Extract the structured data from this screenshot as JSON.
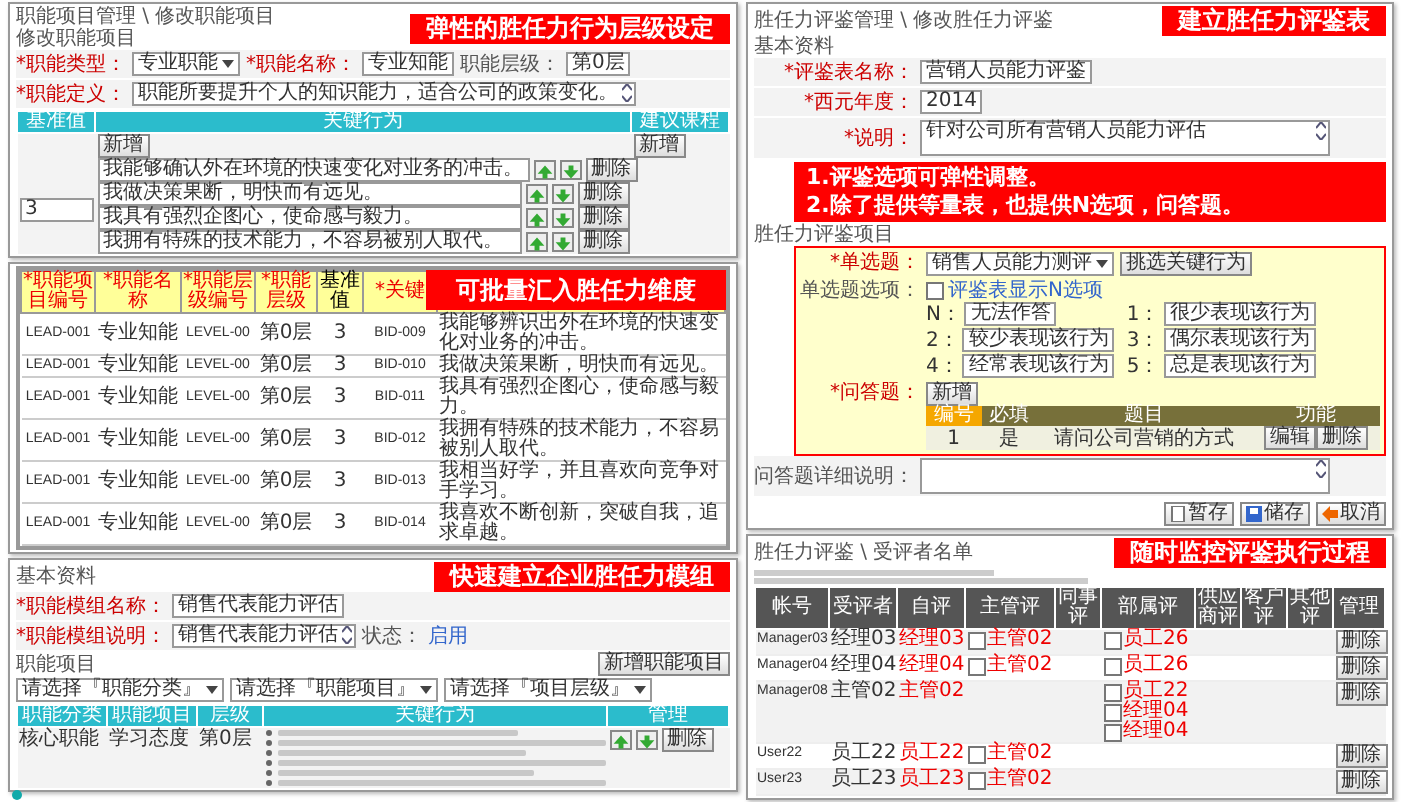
{
  "level_panel": {
    "breadcrumb": "职能项目管理 \\ 修改职能项目",
    "section_title": "修改职能项目",
    "banner": "弹性的胜任力行为层级设定",
    "field_rows": [
      [
        {
          "label": "*职能类型：",
          "kind": "select",
          "value": "专业职能"
        },
        {
          "label": "*职能名称：",
          "kind": "input",
          "value": "专业知能"
        },
        {
          "label": "职能层级：",
          "kind": "input",
          "value": "第0层"
        }
      ],
      [
        {
          "label": "*职能定义：",
          "kind": "textarea",
          "value": "职能所要提升个人的知识能力，适合公司的政策变化。"
        }
      ]
    ],
    "columns": [
      "基准值",
      "关键行为",
      "建议课程"
    ],
    "add_button": "新增",
    "course_add_button": "新增",
    "baseline_value": "3",
    "behaviors": [
      {
        "text": "我能够确认外在环境的快速变化对业务的冲击。",
        "delete": "删除"
      },
      {
        "text": "我做决策果断，明快而有远见。",
        "delete": "删除"
      },
      {
        "text": "我具有强烈企图心，使命感与毅力。",
        "delete": "删除"
      },
      {
        "text": "我拥有特殊的技术能力，不容易被别人取代。",
        "delete": "删除"
      }
    ]
  },
  "import_panel": {
    "banner": "可批量汇入胜任力维度",
    "columns": [
      {
        "label": "*职能项目编号",
        "required": true
      },
      {
        "label": "*职能名称",
        "required": true
      },
      {
        "label": "*职能层级编号",
        "required": true
      },
      {
        "label": "*职能层级",
        "required": true
      },
      {
        "label": "基准值",
        "required": false
      },
      {
        "label": "*关键",
        "required": true
      }
    ],
    "rows": [
      [
        "LEAD-001",
        "专业知能",
        "LEVEL-00",
        "第0层",
        "3",
        "BID-009",
        "我能够辨识出外在环境的快速变化对业务的冲击。"
      ],
      [
        "LEAD-001",
        "专业知能",
        "LEVEL-00",
        "第0层",
        "3",
        "BID-010",
        "我做决策果断，明快而有远见。"
      ],
      [
        "LEAD-001",
        "专业知能",
        "LEVEL-00",
        "第0层",
        "3",
        "BID-011",
        "我具有强烈企图心，使命感与毅力。"
      ],
      [
        "LEAD-001",
        "专业知能",
        "LEVEL-00",
        "第0层",
        "3",
        "BID-012",
        "我拥有特殊的技术能力，不容易被别人取代。"
      ],
      [
        "LEAD-001",
        "专业知能",
        "LEVEL-00",
        "第0层",
        "3",
        "BID-013",
        "我相当好学，并且喜欢向竞争对手学习。"
      ],
      [
        "LEAD-001",
        "专业知能",
        "LEVEL-00",
        "第0层",
        "3",
        "BID-014",
        "我喜欢不断创新，突破自我，追求卓越。"
      ]
    ]
  },
  "model_panel": {
    "section_title": "基本资料",
    "banner": "快速建立企业胜任力模组",
    "field_rows": [
      [
        {
          "label": "*职能模组名称：",
          "kind": "input",
          "value": "销售代表能力评估"
        }
      ],
      [
        {
          "label": "*职能模组说明：",
          "kind": "textarea",
          "value": "销售代表能力评估"
        },
        {
          "label": "状态：",
          "kind": "link",
          "value": "启用"
        }
      ]
    ],
    "items_title": "职能项目",
    "add_item_button": "新增职能项目",
    "filters": [
      "请选择『职能分类』",
      "请选择『职能项目』",
      "请选择『项目层级』"
    ],
    "columns": [
      "职能分类",
      "职能项目",
      "层级",
      "关键行为",
      "管理"
    ],
    "rows": [
      {
        "category": "核心职能",
        "item": "学习态度",
        "level": "第0层",
        "behaviors": [
          {
            "kind": "blurred"
          },
          {
            "kind": "blurred"
          },
          {
            "kind": "blurred"
          },
          {
            "kind": "blurred"
          },
          {
            "kind": "blurred"
          },
          {
            "kind": "blurred"
          }
        ],
        "delete": "删除"
      }
    ]
  },
  "evaluation_panel": {
    "breadcrumb": "胜任力评鉴管理 \\ 修改胜任力评鉴",
    "banner": "建立胜任力评鉴表",
    "section_title": "基本资料",
    "fields": [
      {
        "label": "*评鉴表名称：",
        "kind": "input",
        "value": "营销人员能力评鉴"
      },
      {
        "label": "*西元年度：",
        "kind": "input",
        "value": "2014"
      },
      {
        "label": "*说明：",
        "kind": "textarea",
        "value": "针对公司所有营销人员能力评估"
      }
    ],
    "note_banner": [
      "1.评鉴选项可弹性调整。",
      "2.除了提供等量表，也提供N选项，问答题。"
    ],
    "items_title": "胜任力评鉴项目",
    "single_label": "*单选题：",
    "single_value": "销售人员能力测评",
    "pick_button": "挑选关键行为",
    "options_label": "单选题选项：",
    "show_n": {
      "label": "评鉴表显示N选项",
      "checked": false
    },
    "options": [
      {
        "key": "N：",
        "value": "无法作答"
      },
      {
        "key": "1：",
        "value": "很少表现该行为"
      },
      {
        "key": "2：",
        "value": "较少表现该行为"
      },
      {
        "key": "3：",
        "value": "偶尔表现该行为"
      },
      {
        "key": "4：",
        "value": "经常表现该行为"
      },
      {
        "key": "5：",
        "value": "总是表现该行为"
      }
    ],
    "qa_label": "*问答题：",
    "qa_add": "新增",
    "qa_columns": [
      "编号",
      "必填",
      "题目",
      "功能"
    ],
    "qa_rows": [
      {
        "number": "1",
        "required": "是",
        "question": "请问公司营销的方式",
        "edit": "编辑",
        "delete": "删除"
      }
    ],
    "detail_label": "问答题详细说明：",
    "buttons": [
      {
        "kind": "draft",
        "label": "暂存"
      },
      {
        "kind": "save",
        "label": "储存"
      },
      {
        "kind": "cancel",
        "label": "取消"
      }
    ]
  },
  "monitor_panel": {
    "breadcrumb": "胜任力评鉴 \\ 受评者名单",
    "banner": "随时监控评鉴执行过程",
    "notes": [
      {
        "kind": "blurred"
      },
      {
        "kind": "blurred"
      }
    ],
    "columns": [
      "帐号",
      "受评者",
      "自评",
      "主管评",
      "同事评",
      "部属评",
      "供应商评",
      "客户评",
      "其他评",
      "管理"
    ],
    "rows": [
      {
        "account": "Manager03",
        "name": "经理03",
        "self": "经理03",
        "supervisor": [
          {
            "name": "主管02",
            "checked": false
          }
        ],
        "subordinate": [
          {
            "name": "员工26",
            "checked": false
          }
        ],
        "delete": "删除"
      },
      {
        "account": "Manager04",
        "name": "经理04",
        "self": "经理04",
        "supervisor": [
          {
            "name": "主管02",
            "checked": false
          }
        ],
        "subordinate": [
          {
            "name": "员工26",
            "checked": false
          }
        ],
        "delete": "删除"
      },
      {
        "account": "Manager08",
        "name": "主管02",
        "self": "主管02",
        "supervisor": [],
        "subordinate": [
          {
            "name": "员工22",
            "checked": false
          },
          {
            "name": "经理04",
            "checked": false
          },
          {
            "name": "经理04",
            "checked": false
          }
        ],
        "delete": "删除"
      },
      {
        "account": "User22",
        "name": "员工22",
        "self": "员工22",
        "supervisor": [
          {
            "name": "主管02",
            "checked": false
          }
        ],
        "subordinate": [],
        "delete": "删除"
      },
      {
        "account": "User23",
        "name": "员工23",
        "self": "员工23",
        "supervisor": [
          {
            "name": "主管02",
            "checked": false
          }
        ],
        "subordinate": [],
        "delete": "删除"
      }
    ]
  }
}
